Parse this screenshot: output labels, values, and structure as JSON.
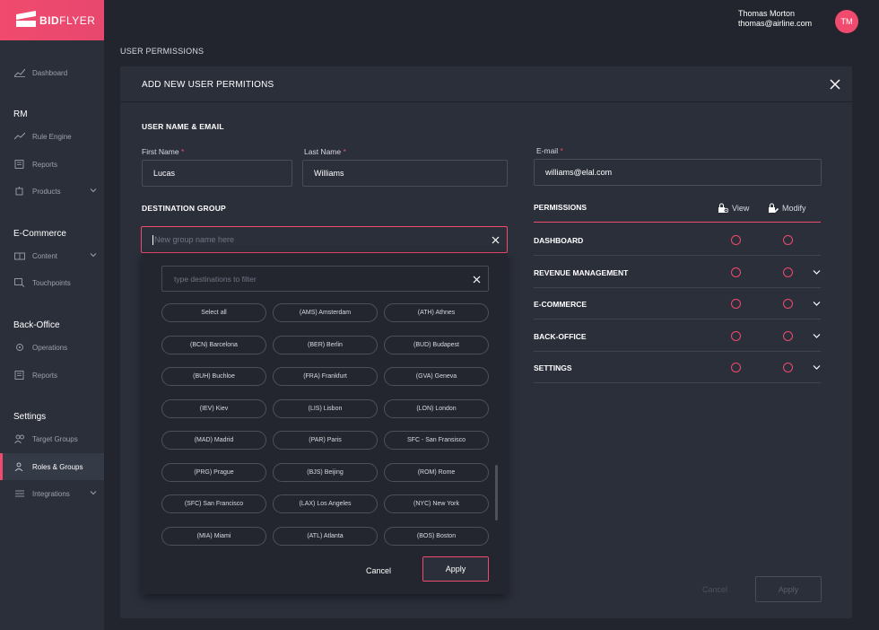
{
  "brand": {
    "bold": "BID",
    "light": "FLYER"
  },
  "user": {
    "name": "Thomas Morton",
    "email": "thomas@airline.com",
    "initials": "TM"
  },
  "sidebar": {
    "dashboard": "Dashboard",
    "sections": [
      "RM",
      "E-Commerce",
      "Back-Office",
      "Settings"
    ],
    "rm": [
      "Rule Engine",
      "Reports",
      "Products"
    ],
    "ecommerce": [
      "Content",
      "Touchpoints"
    ],
    "backoffice": [
      "Operations",
      "Reports"
    ],
    "settings": [
      "Target Groups",
      "Roles & Groups",
      "Integrations"
    ]
  },
  "page": {
    "title": "USER PERMISSIONS"
  },
  "modal": {
    "title": "ADD NEW USER PERMITIONS",
    "user_section": "USER NAME & EMAIL",
    "first_name": {
      "label": "First Name",
      "value": "Lucas"
    },
    "last_name": {
      "label": "Last Name",
      "value": "Williams"
    },
    "email": {
      "label": "E-mail",
      "value": "williams@elal.com"
    },
    "required_mark": "*",
    "dest_section": "DESTINATION GROUP",
    "group_placeholder": "New group name here",
    "filter_placeholder": "type destinations to filter",
    "destinations": [
      "Select all",
      "(AMS) Amsterdam",
      "(ATH) Athnes",
      "(BCN) Barcelona",
      "(BER) Berlin",
      "(BUD) Budapest",
      "(BUH) Buchloe",
      "(FRA) Frankfurt",
      "(GVA) Geneva",
      "(IEV) Kiev",
      "(LIS) Lisbon",
      "(LON) London",
      "(MAD) Madrid",
      "(PAR) Paris",
      "SFC - San Fransisco",
      "(PRG) Prague",
      "(BJS) Beijing",
      "(ROM) Rome",
      "(SFC) San Francisco",
      "(LAX) Los Angeles",
      "(NYC) New York",
      "(MIA) Miami",
      "(ATL) Atlanta",
      "(BOS) Boston"
    ],
    "dropdown_cancel": "Cancel",
    "dropdown_apply": "Apply",
    "permissions": {
      "title": "PERMISSIONS",
      "view_label": "View",
      "modify_label": "Modify",
      "rows": [
        "DASHBOARD",
        "REVENUE MANAGEMENT",
        "E-COMMERCE",
        "BACK-OFFICE",
        "SETTINGS"
      ]
    },
    "cancel": "Cancel",
    "apply": "Apply"
  },
  "colors": {
    "accent": "#f04a6e",
    "background": "#22252e",
    "panel": "#2b2f3a"
  }
}
